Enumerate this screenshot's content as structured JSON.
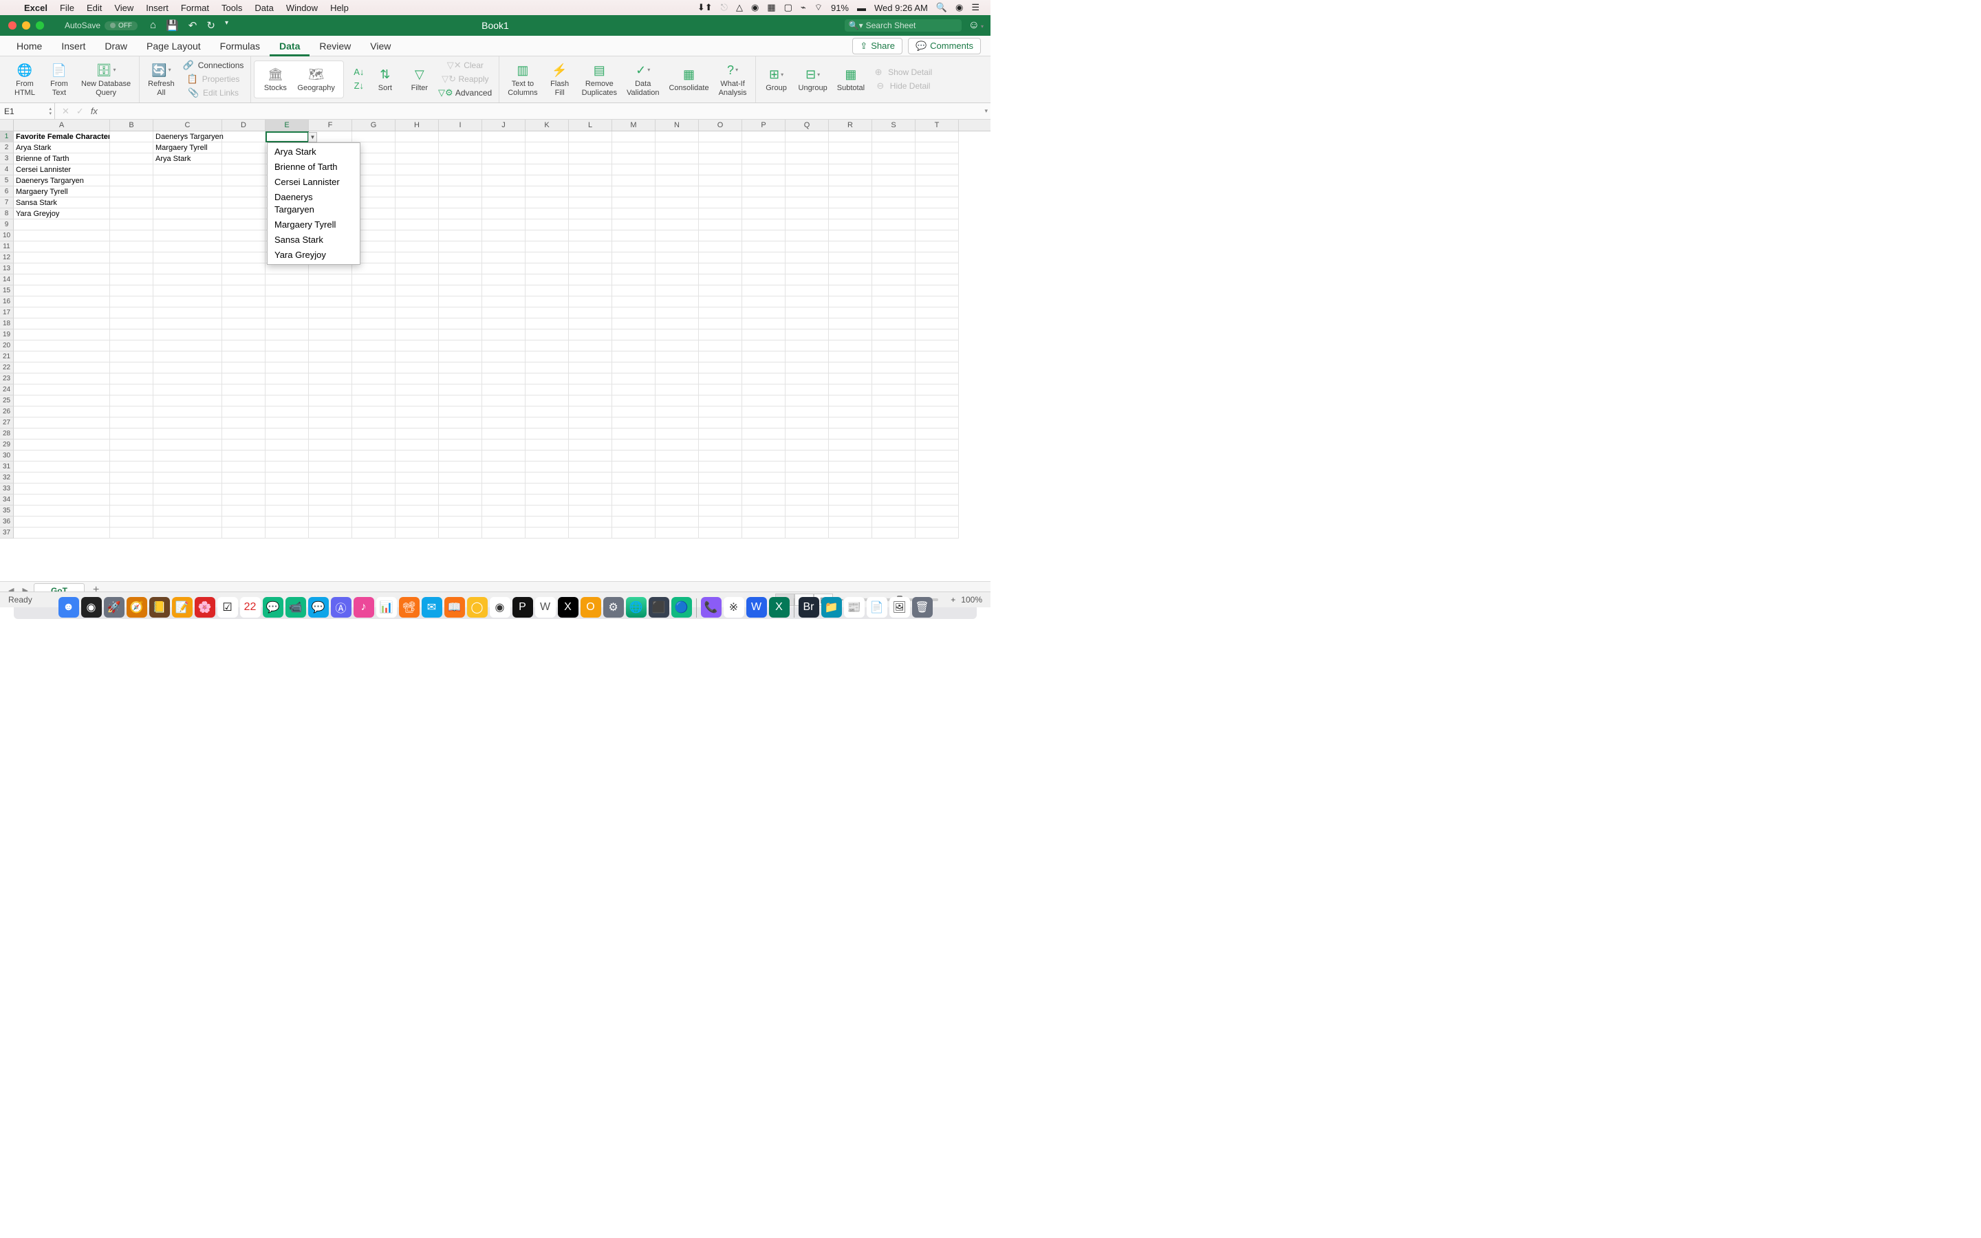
{
  "menubar": {
    "app": "Excel",
    "items": [
      "File",
      "Edit",
      "View",
      "Insert",
      "Format",
      "Tools",
      "Data",
      "Window",
      "Help"
    ],
    "battery": "91%",
    "clock": "Wed 9:26 AM"
  },
  "titlebar": {
    "autosave_label": "AutoSave",
    "autosave_state": "OFF",
    "doc_title": "Book1",
    "search_placeholder": "Search Sheet"
  },
  "tabs": {
    "items": [
      "Home",
      "Insert",
      "Draw",
      "Page Layout",
      "Formulas",
      "Data",
      "Review",
      "View"
    ],
    "active": "Data",
    "share": "Share",
    "comments": "Comments"
  },
  "ribbon": {
    "from_html": "From\nHTML",
    "from_text": "From\nText",
    "new_db_query": "New Database\nQuery",
    "refresh_all": "Refresh\nAll",
    "connections": "Connections",
    "properties": "Properties",
    "edit_links": "Edit Links",
    "stocks": "Stocks",
    "geography": "Geography",
    "sort": "Sort",
    "filter": "Filter",
    "clear": "Clear",
    "reapply": "Reapply",
    "advanced": "Advanced",
    "text_to_columns": "Text to\nColumns",
    "flash_fill": "Flash\nFill",
    "remove_duplicates": "Remove\nDuplicates",
    "data_validation": "Data\nValidation",
    "consolidate": "Consolidate",
    "whatif": "What-If\nAnalysis",
    "group": "Group",
    "ungroup": "Ungroup",
    "subtotal": "Subtotal",
    "show_detail": "Show Detail",
    "hide_detail": "Hide Detail"
  },
  "formula_bar": {
    "name_box": "E1"
  },
  "columns": [
    "A",
    "B",
    "C",
    "D",
    "E",
    "F",
    "G",
    "H",
    "I",
    "J",
    "K",
    "L",
    "M",
    "N",
    "O",
    "P",
    "Q",
    "R",
    "S",
    "T"
  ],
  "cells": {
    "A1": "Favorite Female Characters",
    "A2": "Arya Stark",
    "A3": "Brienne of Tarth",
    "A4": "Cersei Lannister",
    "A5": "Daenerys Targaryen",
    "A6": "Margaery Tyrell",
    "A7": "Sansa Stark",
    "A8": "Yara Greyjoy",
    "C1": "Daenerys Targaryen",
    "C2": "Margaery Tyrell",
    "C3": "Arya Stark"
  },
  "dropdown_options": [
    "Arya Stark",
    "Brienne of Tarth",
    "Cersei Lannister",
    "Daenerys Targaryen",
    "Margaery Tyrell",
    "Sansa Stark",
    "Yara Greyjoy"
  ],
  "selected_cell": "E1",
  "sheet": {
    "name": "GoT"
  },
  "status": {
    "ready": "Ready",
    "zoom": "100%"
  }
}
